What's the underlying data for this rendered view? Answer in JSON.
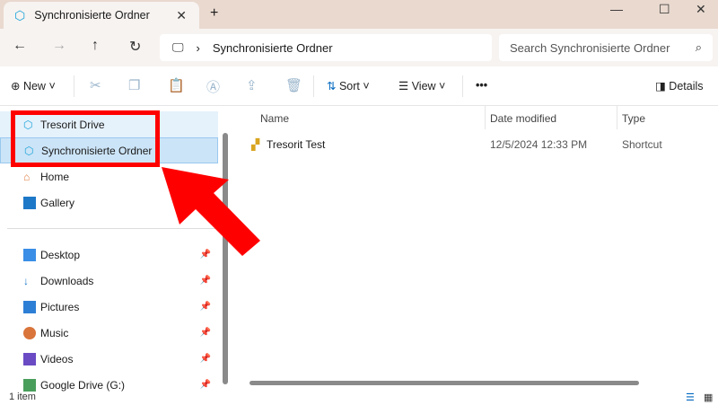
{
  "window": {
    "tab_title": "Synchronisierte Ordner"
  },
  "address": {
    "path": "Synchronisierte Ordner",
    "search_placeholder": "Search Synchronisierte Ordner"
  },
  "toolbar": {
    "new": "New",
    "sort": "Sort",
    "view": "View",
    "more": "•••",
    "details": "Details"
  },
  "sidebar": {
    "items": [
      {
        "label": "Tresorit Drive"
      },
      {
        "label": "Synchronisierte Ordner"
      },
      {
        "label": "Home"
      },
      {
        "label": "Gallery"
      },
      {
        "label": "Desktop"
      },
      {
        "label": "Downloads"
      },
      {
        "label": "Pictures"
      },
      {
        "label": "Music"
      },
      {
        "label": "Videos"
      },
      {
        "label": "Google Drive (G:)"
      }
    ]
  },
  "columns": {
    "name": "Name",
    "date": "Date modified",
    "type": "Type"
  },
  "files": [
    {
      "name": "Tresorit Test",
      "date": "12/5/2024 12:33 PM",
      "type": "Shortcut"
    }
  ],
  "status": {
    "count": "1 item"
  },
  "colors": {
    "accent": "#0067c0",
    "highlight": "#ff0000"
  }
}
